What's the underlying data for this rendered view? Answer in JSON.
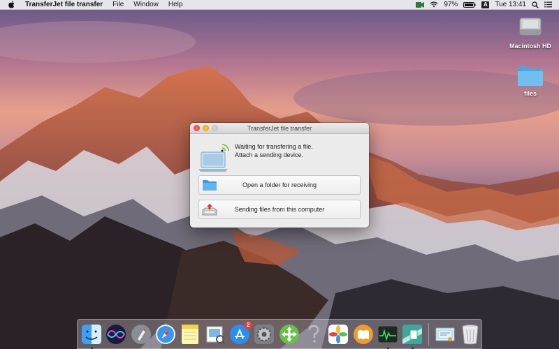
{
  "menubar": {
    "app_name": "TransferJet file transfer",
    "menus": [
      "File",
      "Window",
      "Help"
    ],
    "battery": "97%",
    "input_source": "A",
    "clock": "Tue 13:41"
  },
  "desktop": {
    "icons": [
      {
        "label": "Macintosh HD",
        "icon": "hard-drive-icon"
      },
      {
        "label": "files",
        "icon": "folder-icon"
      }
    ]
  },
  "window": {
    "title": "TransferJet file transfer",
    "status_line1": "Waiting for transfering a file.",
    "status_line2": "Attach a sending device.",
    "buttons": [
      {
        "label": "Open a folder for receiving",
        "icon": "folder-icon"
      },
      {
        "label": "Sending files from this computer",
        "icon": "upload-tray-icon"
      }
    ]
  },
  "dock": {
    "app_store_badge": "2",
    "items": [
      "finder-icon",
      "siri-icon",
      "launchpad-icon",
      "safari-icon",
      "notes-icon",
      "preview-icon",
      "app-store-icon",
      "system-preferences-icon",
      "transferjet-icon",
      "help-icon",
      "photos-icon",
      "ibooks-icon",
      "activity-monitor-icon",
      "transferjet-app-icon",
      "certificate-icon",
      "trash-icon"
    ]
  },
  "colors": {
    "close": "#fc5f57",
    "minimize": "#fdbc2e",
    "folder_blue": "#5ab4ea",
    "badge_red": "#e0403a"
  }
}
